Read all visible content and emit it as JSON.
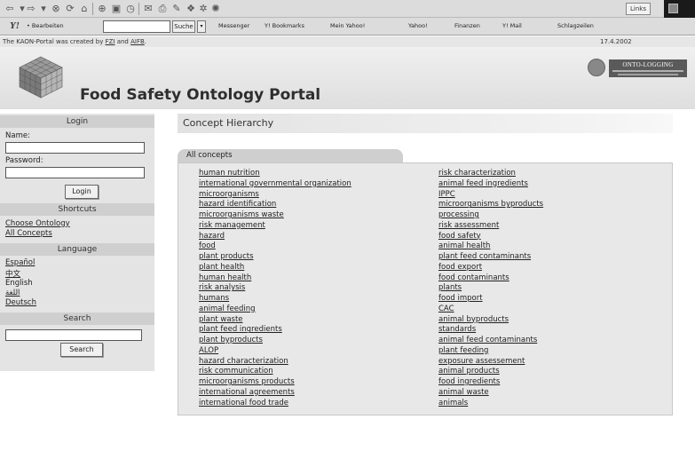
{
  "browser": {
    "toolbar_icons": [
      "back-icon",
      "forward-icon",
      "stop-icon",
      "refresh-icon",
      "home-icon",
      "search-icon",
      "favorites-icon",
      "history-icon",
      "mail-icon",
      "print-icon",
      "edit-icon",
      "discuss-icon",
      "messenger-icon",
      "media-icon"
    ],
    "links_label": "Links",
    "yahoo_bar": {
      "edit_label": "• Bearbeiten",
      "search_button": "Suche",
      "items": [
        "Messenger",
        "Y! Bookmarks",
        "Mein Yahoo!",
        "Yahoo!",
        "Finanzen",
        "Y! Mail",
        "Schlagzeilen"
      ]
    }
  },
  "credit": {
    "prefix": "The KAON-Portal was created by ",
    "fzi": "FZI",
    "and": " and ",
    "aifb": "AIFB",
    "suffix": ".",
    "date": "17.4.2002"
  },
  "header": {
    "title": "Food Safety Ontology Portal",
    "badge_text": "ONTO-LOGGING"
  },
  "sidebar": {
    "login_heading": "Login",
    "name_label": "Name:",
    "password_label": "Password:",
    "login_button": "Login",
    "shortcuts_heading": "Shortcuts",
    "shortcuts": [
      "Choose Ontology",
      "All Concepts"
    ],
    "language_heading": "Language",
    "languages": [
      "Español",
      "中文",
      "English",
      "اللغة",
      "Deutsch"
    ],
    "search_heading": "Search",
    "search_button": "Search"
  },
  "main": {
    "section_title": "Concept Hierarchy",
    "tab_label": "All concepts",
    "column_left": [
      "human nutrition",
      "international governmental organization",
      "microorganisms",
      "hazard identification",
      "microorganisms waste",
      "risk management",
      "hazard",
      "food",
      "plant products",
      "plant health",
      "human health",
      "risk analysis",
      "humans",
      "animal feeding",
      "plant waste",
      "plant feed ingredients",
      "plant byproducts",
      "ALOP",
      "hazard characterization",
      "risk communication",
      "microorganisms products",
      "international agreements",
      "international food trade"
    ],
    "column_right": [
      "risk characterization",
      "animal feed ingredients",
      "IPPC",
      "microorganisms byproducts",
      "processing",
      "risk assessment",
      "food safety",
      "animal health",
      "plant feed contaminants",
      "food export",
      "food contaminants",
      "plants",
      "food import",
      "CAC",
      "animal byproducts",
      "standards",
      "animal feed contaminants",
      "plant feeding",
      "exposure assessement",
      "animal products",
      "food ingredients",
      "animal waste",
      "animals"
    ]
  }
}
